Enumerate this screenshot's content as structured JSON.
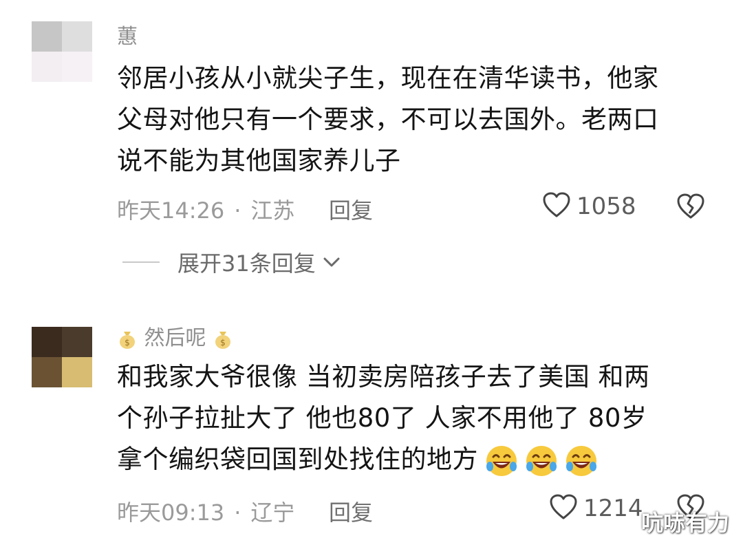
{
  "comments": [
    {
      "username": "蕙",
      "lines": [
        "邻居小孩从小就尖子生，现在在清华读书，他家",
        "父母对他只有一个要求，不可以去国外。老两口",
        "说不能为其他国家养儿子"
      ],
      "time": "昨天14:26",
      "location": "江苏",
      "reply_label": "回复",
      "likes": "1058",
      "expand_label": "展开31条回复"
    },
    {
      "username": "然后呢",
      "lines": [
        "和我家大爷很像 当初卖房陪孩子去了美国 和两",
        "个孙子拉扯大了 他也80了 人家不用他了 80岁",
        "拿个编织袋回国到处找住的地方"
      ],
      "time": "昨天09:13",
      "location": "辽宁",
      "reply_label": "回复",
      "likes": "1214"
    }
  ],
  "separator": "·",
  "watermark": "吭哧有力",
  "icons": {
    "like": "heart-outline-icon",
    "dislike": "broken-heart-icon",
    "expand": "chevron-down-icon",
    "username_decoration": "money-bag-icon",
    "emoji": "rolling-laughing-emoji-icon"
  },
  "colors": {
    "username": "#8f8f8f",
    "body": "#141414",
    "meta": "#9a9a9a",
    "avatar_1": [
      "#c6c6c6",
      "#dedede",
      "#f3eef2",
      "#f6f1f5"
    ],
    "avatar_2": [
      "#3b2a1e",
      "#4a3b2c",
      "#6a5233",
      "#d7bc72"
    ]
  }
}
